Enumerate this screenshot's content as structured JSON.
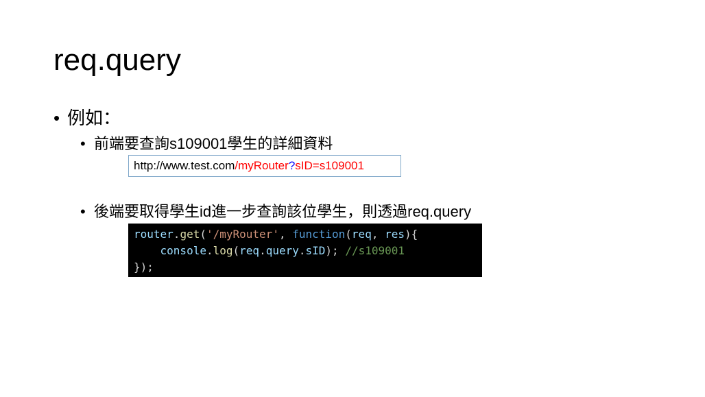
{
  "slide": {
    "title": "req.query",
    "bullet_char": "•",
    "bullet1": "例如：",
    "bullet2": "前端要查詢s109001學生的詳細資料",
    "url": {
      "part1": "http://www.test.com",
      "part2": "/myRouter",
      "part3": "?",
      "part4": "sID=s109001",
      "colors": {
        "default": "#000000",
        "path": "#ff0000",
        "query_mark": "#0000ff",
        "param": "#ff0000"
      }
    },
    "bullet3": "後端要取得學生id進一步查詢該位學生，則透過req.query",
    "code": {
      "line1": {
        "t1": "router",
        "t2": ".",
        "t3": "get",
        "t4": "(",
        "t5": "'/myRouter'",
        "t6": ", ",
        "t7": "function",
        "t8": "(",
        "t9": "req",
        "t10": ", ",
        "t11": "res",
        "t12": "){"
      },
      "line2": {
        "indent": "    ",
        "t1": "console",
        "t2": ".",
        "t3": "log",
        "t4": "(",
        "t5": "req",
        "t6": ".",
        "t7": "query",
        "t8": ".",
        "t9": "sID",
        "t10": "); ",
        "t11": "//s109001"
      },
      "line3": "});",
      "colors": {
        "background": "#000000",
        "identifier": "#9cdcfe",
        "function": "#dcdcaa",
        "string": "#ce9178",
        "keyword": "#569cd6",
        "comment": "#6a9955"
      }
    }
  }
}
